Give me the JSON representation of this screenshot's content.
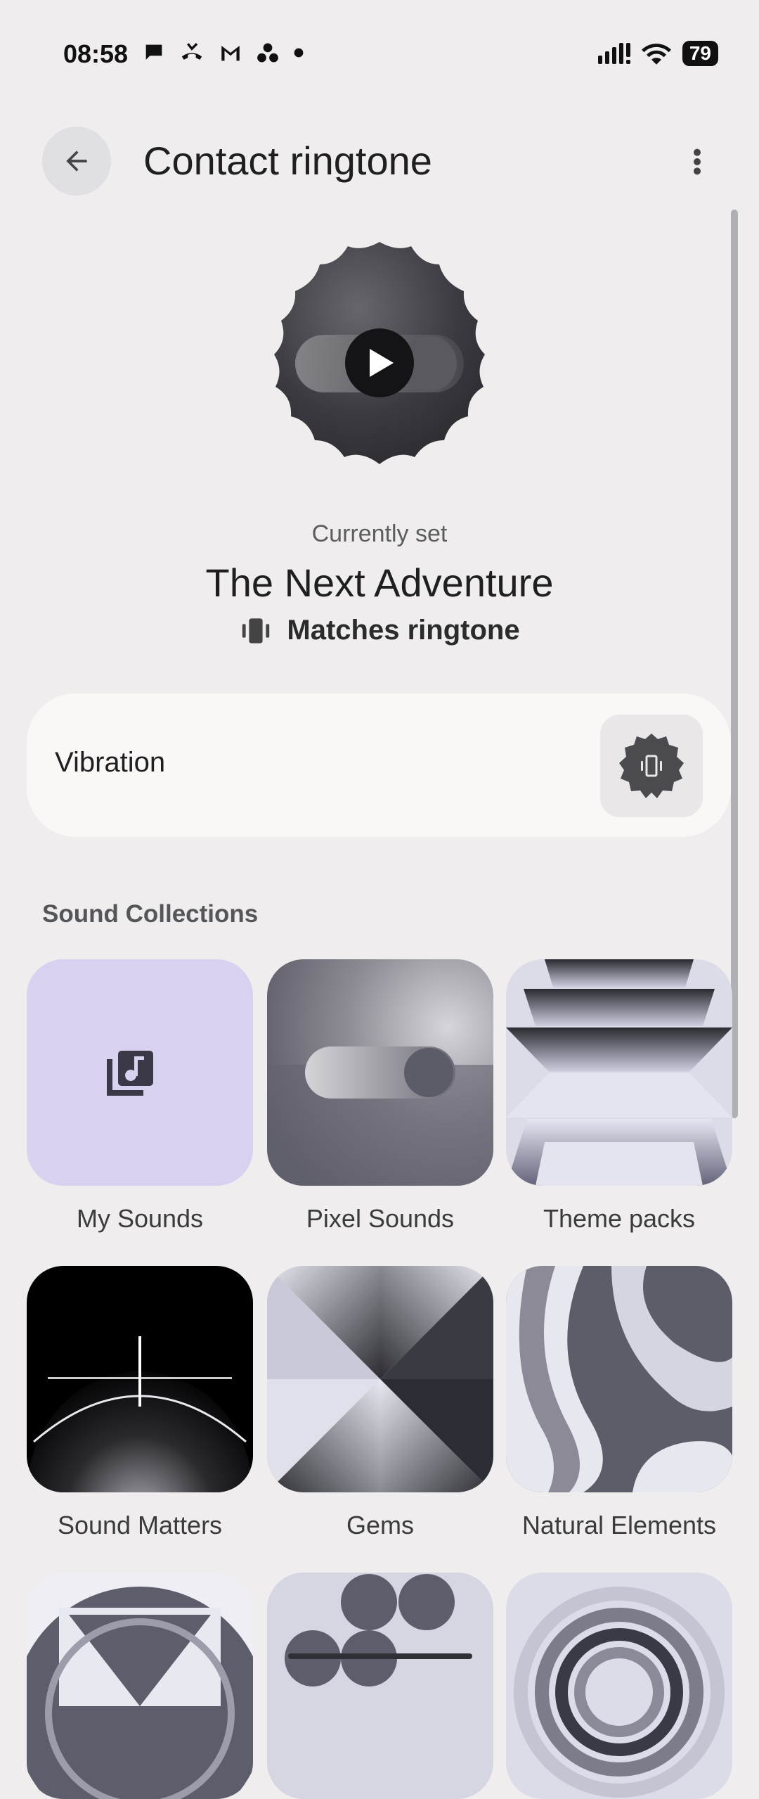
{
  "status_bar": {
    "time": "08:58",
    "battery": "79"
  },
  "app_bar": {
    "title": "Contact ringtone"
  },
  "current": {
    "caption": "Currently set",
    "name": "The Next Adventure",
    "vibration_match": "Matches ringtone"
  },
  "vibration": {
    "label": "Vibration"
  },
  "collections": {
    "heading": "Sound Collections",
    "items": [
      {
        "label": "My Sounds"
      },
      {
        "label": "Pixel Sounds"
      },
      {
        "label": "Theme packs"
      },
      {
        "label": "Sound Matters"
      },
      {
        "label": "Gems"
      },
      {
        "label": "Natural Elements"
      }
    ]
  },
  "colors": {
    "background": "#efeded",
    "card": "#faf7f7",
    "my_sounds_tile": "#d8d1ef",
    "accent_dark": "#3a3a3f"
  }
}
